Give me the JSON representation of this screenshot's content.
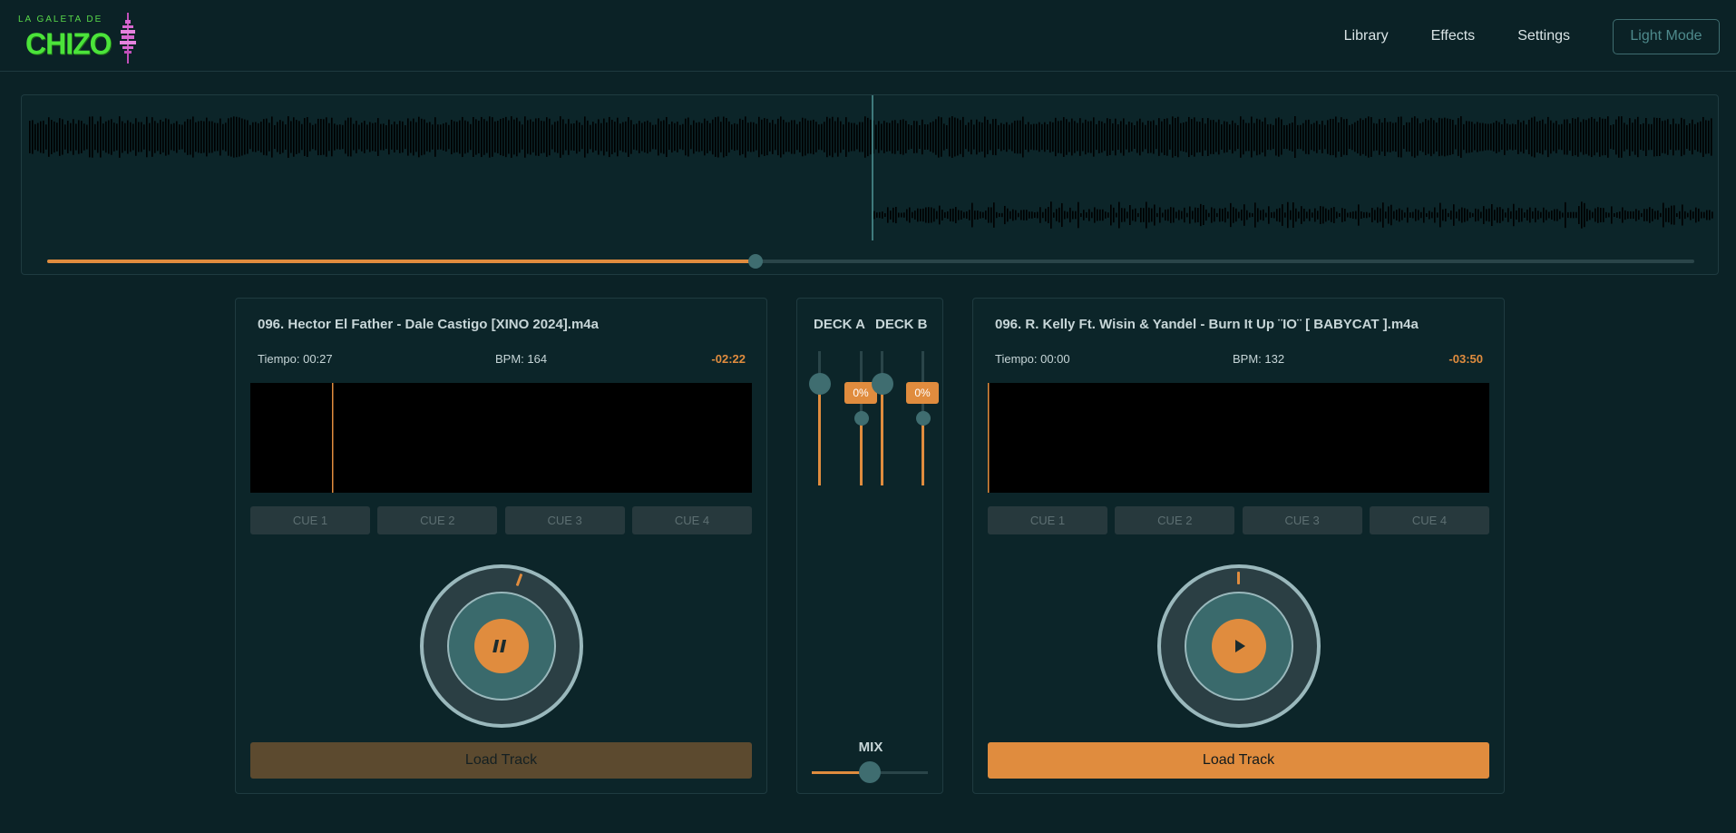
{
  "header": {
    "logo_small": "LA GALETA DE",
    "logo_big": "CHIZO",
    "nav": [
      "Library",
      "Effects",
      "Settings"
    ],
    "light_mode": "Light Mode"
  },
  "overview": {
    "progress": 0.43
  },
  "deck_a": {
    "title": "096. Hector El Father - Dale Castigo [XINO 2024].m4a",
    "time": "Tiempo: 00:27",
    "bpm": "BPM: 164",
    "remaining": "-02:22",
    "cues": [
      "CUE 1",
      "CUE 2",
      "CUE 3",
      "CUE 4"
    ],
    "state": "playing",
    "load_label": "Load Track"
  },
  "deck_b": {
    "title": "096. R. Kelly Ft. Wisin & Yandel - Burn It Up ¨IO¨ [ BABYCAT ].m4a",
    "time": "Tiempo: 00:00",
    "bpm": "BPM: 132",
    "remaining": "-03:50",
    "cues": [
      "CUE 1",
      "CUE 2",
      "CUE 3",
      "CUE 4"
    ],
    "state": "paused",
    "load_label": "Load Track"
  },
  "mixer": {
    "deck_a_label": "DECK A",
    "deck_b_label": "DECK B",
    "deck_a_pitch": "0%",
    "deck_b_pitch": "0%",
    "mix_label": "MIX",
    "crossfader": 0.5
  },
  "colors": {
    "accent": "#e08c3e",
    "background": "#0b2226",
    "panel": "#0c2529",
    "thumb": "#3f6d70"
  }
}
